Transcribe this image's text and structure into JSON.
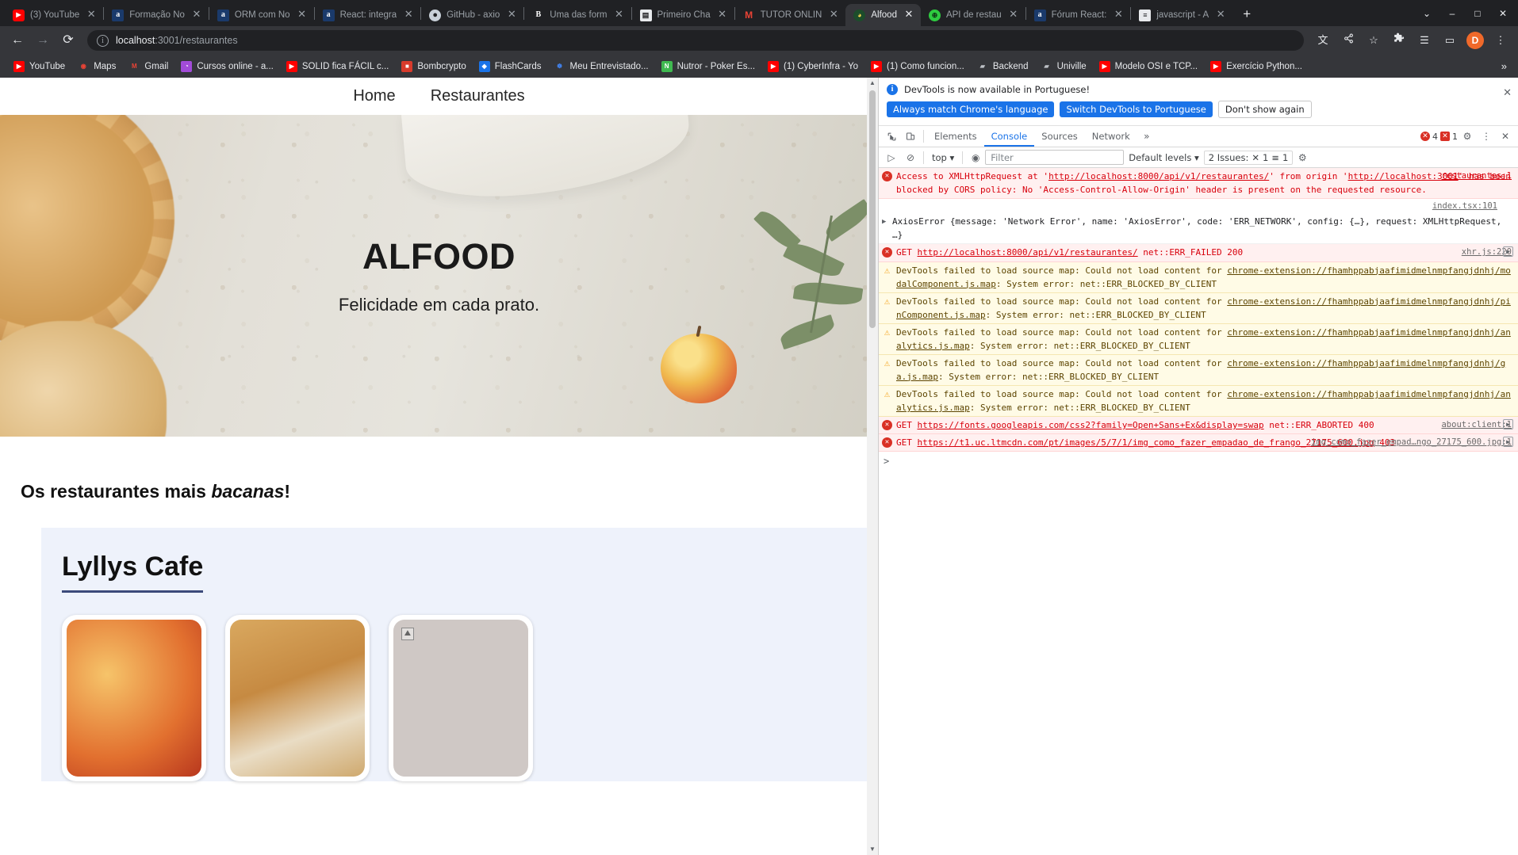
{
  "window": {
    "minimize_label": "–",
    "maximize_label": "□",
    "close_label": "✕",
    "newtab_label": "+",
    "tablist_label": "⌄"
  },
  "tabs": [
    {
      "title": "(3) YouTube",
      "favicon": "youtube-icon",
      "glyph": "▶",
      "active": false
    },
    {
      "title": "Formação No",
      "favicon": "alura-icon",
      "glyph": "a",
      "active": false
    },
    {
      "title": "ORM com No",
      "favicon": "alura-icon",
      "glyph": "a",
      "active": false
    },
    {
      "title": "React: integra",
      "favicon": "alura-icon",
      "glyph": "a",
      "active": false
    },
    {
      "title": "GitHub - axio",
      "favicon": "github-icon",
      "glyph": "●",
      "active": false
    },
    {
      "title": "Uma das form",
      "favicon": "medium-icon",
      "glyph": "B",
      "active": false
    },
    {
      "title": "Primeiro Cha",
      "favicon": "book-icon",
      "glyph": "▤",
      "active": false
    },
    {
      "title": "TUTOR ONLIN",
      "favicon": "gmail-icon",
      "glyph": "M",
      "active": false
    },
    {
      "title": "Alfood",
      "favicon": "alfood-icon",
      "glyph": "◕",
      "active": true
    },
    {
      "title": "API de restau",
      "favicon": "api-icon",
      "glyph": "⊕",
      "active": false
    },
    {
      "title": "Fórum React:",
      "favicon": "alura-icon",
      "glyph": "a",
      "active": false
    },
    {
      "title": "javascript - A",
      "favicon": "stackoverflow-icon",
      "glyph": "≡",
      "active": false
    }
  ],
  "toolbar": {
    "back_label": "←",
    "forward_label": "→",
    "reload_label": "⟳",
    "url_host": "localhost",
    "url_rest": ":3001/restaurantes",
    "site_info_icon": "i",
    "translate_label": "文",
    "share_label": "share-icon",
    "bookmark_label": "☆",
    "extensions_label": "❖",
    "reading_list_label": "☰",
    "sidepanel_label": "▭",
    "profile_initial": "D",
    "menu_label": "⋮"
  },
  "bookmarks": {
    "items": [
      {
        "label": "YouTube",
        "icon": "youtube-icon",
        "glyph": "▶"
      },
      {
        "label": "Maps",
        "icon": "maps-icon",
        "glyph": "◉"
      },
      {
        "label": "Gmail",
        "icon": "gmail-icon",
        "glyph": "M"
      },
      {
        "label": "Cursos online - a...",
        "icon": "alura-icon",
        "glyph": "◔"
      },
      {
        "label": "SOLID fica FÁCIL c...",
        "icon": "youtube-icon",
        "glyph": "▶"
      },
      {
        "label": "Bombcrypto",
        "icon": "bombcrypto-icon",
        "glyph": "■"
      },
      {
        "label": "FlashCards",
        "icon": "flashcards-icon",
        "glyph": "◆"
      },
      {
        "label": "Meu Entrevistado...",
        "icon": "entrevistado-icon",
        "glyph": "☸"
      },
      {
        "label": "Nutror - Poker Es...",
        "icon": "nutror-icon",
        "glyph": "N"
      },
      {
        "label": "(1) CyberInfra - Yo",
        "icon": "youtube-icon",
        "glyph": "▶"
      },
      {
        "label": "(1) Como funcion...",
        "icon": "youtube-icon",
        "glyph": "▶"
      },
      {
        "label": "Backend",
        "icon": "folder-icon",
        "glyph": "▰"
      },
      {
        "label": "Univille",
        "icon": "folder-icon",
        "glyph": "▰"
      },
      {
        "label": "Modelo OSI e TCP...",
        "icon": "youtube-icon",
        "glyph": "▶"
      },
      {
        "label": "Exercício Python...",
        "icon": "youtube-icon",
        "glyph": "▶"
      }
    ],
    "overflow_label": "»"
  },
  "page": {
    "nav": [
      {
        "label": "Home"
      },
      {
        "label": "Restaurantes"
      }
    ],
    "hero": {
      "title": "ALFOOD",
      "subtitle": "Felicidade em cada prato."
    },
    "section_title_prefix": "Os restaurantes mais ",
    "section_title_emph": "bacanas",
    "section_title_suffix": "!",
    "restaurants": [
      {
        "name": "Lyllys Cafe",
        "dishes": [
          {
            "alt": "lasanha-dish"
          },
          {
            "alt": "massa-dish"
          },
          {
            "alt": "broken-image-dish"
          }
        ]
      }
    ]
  },
  "devtools": {
    "banner": {
      "message": "DevTools is now available in Portuguese!",
      "info_icon": "i",
      "buttons": [
        {
          "label": "Always match Chrome's language",
          "style": "primary"
        },
        {
          "label": "Switch DevTools to Portuguese",
          "style": "primary"
        },
        {
          "label": "Don't show again",
          "style": "plain"
        }
      ],
      "close_label": "✕"
    },
    "tabs": [
      {
        "label": "Elements",
        "selected": false
      },
      {
        "label": "Console",
        "selected": true
      },
      {
        "label": "Sources",
        "selected": false
      },
      {
        "label": "Network",
        "selected": false
      }
    ],
    "tabs_overflow_label": "»",
    "inspect_icon_label": "↖",
    "device_icon_label": "□",
    "error_badge_count": "4",
    "warning_badge_count": "1",
    "settings_label": "⚙",
    "more_label": "⋮",
    "close_label": "✕",
    "filterbar": {
      "execute_label": "▷",
      "clear_label": "⊘",
      "context": "top",
      "context_caret": "▾",
      "eye_label": "◉",
      "filter_placeholder": "Filter",
      "filter_value": "",
      "levels": "Default levels",
      "levels_caret": "▾",
      "issues_label": "2 Issues:",
      "issues_error_count": "1",
      "issues_info_count": "1",
      "gear_label": "⚙"
    },
    "messages": [
      {
        "type": "error",
        "icon": "error-icon",
        "source": "restaurantes:1",
        "source_style": "red",
        "parts": [
          {
            "t": "Access to XMLHttpRequest at '",
            "link": false
          },
          {
            "t": "http://localhost:8000/api/v1/restaurantes/",
            "link": true
          },
          {
            "t": "' from origin '",
            "link": false
          },
          {
            "t": "http://localhost:3001",
            "link": true
          },
          {
            "t": "' has been blocked by CORS policy: No 'Access-Control-Allow-Origin' header is present on the requested resource.",
            "link": false
          }
        ]
      },
      {
        "type": "plain",
        "icon": "expand-icon",
        "srcline": "index.tsx:101",
        "parts": [
          {
            "t": "AxiosError ",
            "link": false
          },
          {
            "t": "{message: 'Network Error', name: 'AxiosError', code: 'ERR_NETWORK', config: {…}, request: XMLHttpRequest, …}",
            "link": false
          }
        ]
      },
      {
        "type": "error",
        "icon": "error-icon",
        "source": "xhr.js:220",
        "source_style": "grey",
        "has_play": true,
        "parts": [
          {
            "t": "GET ",
            "link": false
          },
          {
            "t": "http://localhost:8000/api/v1/restaurantes/",
            "link": true
          },
          {
            "t": " net::ERR_FAILED 200",
            "link": false
          }
        ]
      },
      {
        "type": "warning",
        "icon": "warning-icon",
        "parts": [
          {
            "t": "DevTools failed to load source map: Could not load content for ",
            "link": false
          },
          {
            "t": "chrome-extension://fhamhppabjaafimidmelnmpfangjdnhj/modalComponent.js.map",
            "link": true
          },
          {
            "t": ": System error: net::ERR_BLOCKED_BY_CLIENT",
            "link": false
          }
        ]
      },
      {
        "type": "warning",
        "icon": "warning-icon",
        "parts": [
          {
            "t": "DevTools failed to load source map: Could not load content for ",
            "link": false
          },
          {
            "t": "chrome-extension://fhamhppabjaafimidmelnmpfangjdnhj/pinComponent.js.map",
            "link": true
          },
          {
            "t": ": System error: net::ERR_BLOCKED_BY_CLIENT",
            "link": false
          }
        ]
      },
      {
        "type": "warning",
        "icon": "warning-icon",
        "parts": [
          {
            "t": "DevTools failed to load source map: Could not load content for ",
            "link": false
          },
          {
            "t": "chrome-extension://fhamhppabjaafimidmelnmpfangjdnhj/analytics.js.map",
            "link": true
          },
          {
            "t": ": System error: net::ERR_BLOCKED_BY_CLIENT",
            "link": false
          }
        ]
      },
      {
        "type": "warning",
        "icon": "warning-icon",
        "parts": [
          {
            "t": "DevTools failed to load source map: Could not load content for ",
            "link": false
          },
          {
            "t": "chrome-extension://fhamhppabjaafimidmelnmpfangjdnhj/ga.js.map",
            "link": true
          },
          {
            "t": ": System error: net::ERR_BLOCKED_BY_CLIENT",
            "link": false
          }
        ]
      },
      {
        "type": "warning",
        "icon": "warning-icon",
        "parts": [
          {
            "t": "DevTools failed to load source map: Could not load content for ",
            "link": false
          },
          {
            "t": "chrome-extension://fhamhppabjaafimidmelnmpfangjdnhj/analytics.js.map",
            "link": true
          },
          {
            "t": ": System error: net::ERR_BLOCKED_BY_CLIENT",
            "link": false
          }
        ]
      },
      {
        "type": "error",
        "icon": "error-icon",
        "source": "about:client:1",
        "source_style": "grey",
        "has_play": true,
        "parts": [
          {
            "t": "GET ",
            "link": false
          },
          {
            "t": "https://fonts.googleapis.com/css2?family=Open+Sans+Ex&display=swap",
            "link": true
          },
          {
            "t": " net::ERR_ABORTED 400",
            "link": false
          }
        ]
      },
      {
        "type": "error",
        "icon": "error-icon",
        "source": "img_como_fazer_empad…ngo_27175_600.jpg:1",
        "source_style": "grey",
        "has_play": true,
        "has_expand": true,
        "parts": [
          {
            "t": "GET ",
            "link": false
          },
          {
            "t": "https://t1.uc.ltmcdn.com/pt/images/5/7/1/img_como_fazer_empadao_de_frango_27175_600.jpg",
            "link": true
          },
          {
            "t": " 403",
            "link": false
          }
        ]
      }
    ],
    "prompt_caret": ">"
  }
}
